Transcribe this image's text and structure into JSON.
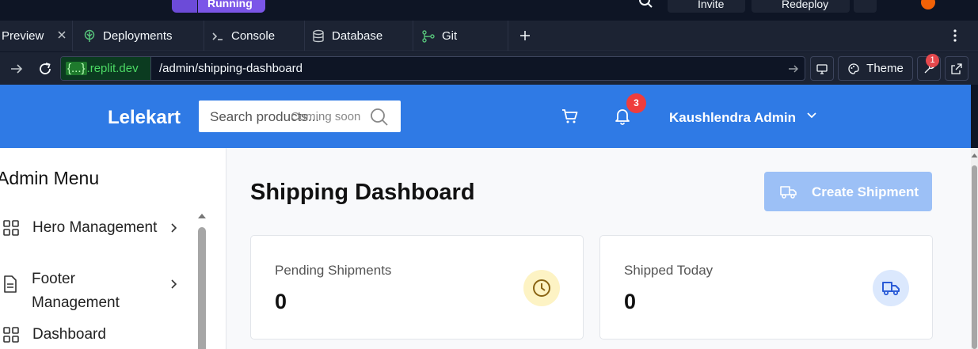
{
  "topbar": {
    "run_label": "Running",
    "invite_label": "Invite",
    "redeploy_label": "Redeploy"
  },
  "tabs": [
    {
      "label": "Preview",
      "icon": "close-icon"
    },
    {
      "label": "Deployments",
      "icon": "deployments-icon"
    },
    {
      "label": "Console",
      "icon": "terminal-icon"
    },
    {
      "label": "Database",
      "icon": "database-icon"
    },
    {
      "label": "Git",
      "icon": "git-icon"
    }
  ],
  "urlbar": {
    "domain_token": "{...}",
    "domain_suffix": ".replit.dev",
    "path": "/admin/shipping-dashboard",
    "theme_label": "Theme",
    "devtools_badge": "1"
  },
  "app": {
    "brand": "Lelekart",
    "search_placeholder": "Search products...",
    "search_soon": "Coming soon",
    "notification_count": "3",
    "user_name": "Kaushlendra Admin",
    "colors": {
      "navbar": "#2f7ae5",
      "button": "#9cc0f6"
    }
  },
  "sidebar": {
    "title": "Admin Menu",
    "items": [
      {
        "label": "Hero Management",
        "icon": "grid-icon"
      },
      {
        "label": "Footer Management",
        "icon": "document-icon"
      },
      {
        "label": "Dashboard",
        "icon": "grid-icon"
      }
    ]
  },
  "main": {
    "title": "Shipping Dashboard",
    "create_button": "Create Shipment",
    "cards": [
      {
        "label": "Pending Shipments",
        "value": "0",
        "icon": "clock-icon"
      },
      {
        "label": "Shipped Today",
        "value": "0",
        "icon": "truck-icon"
      }
    ]
  }
}
